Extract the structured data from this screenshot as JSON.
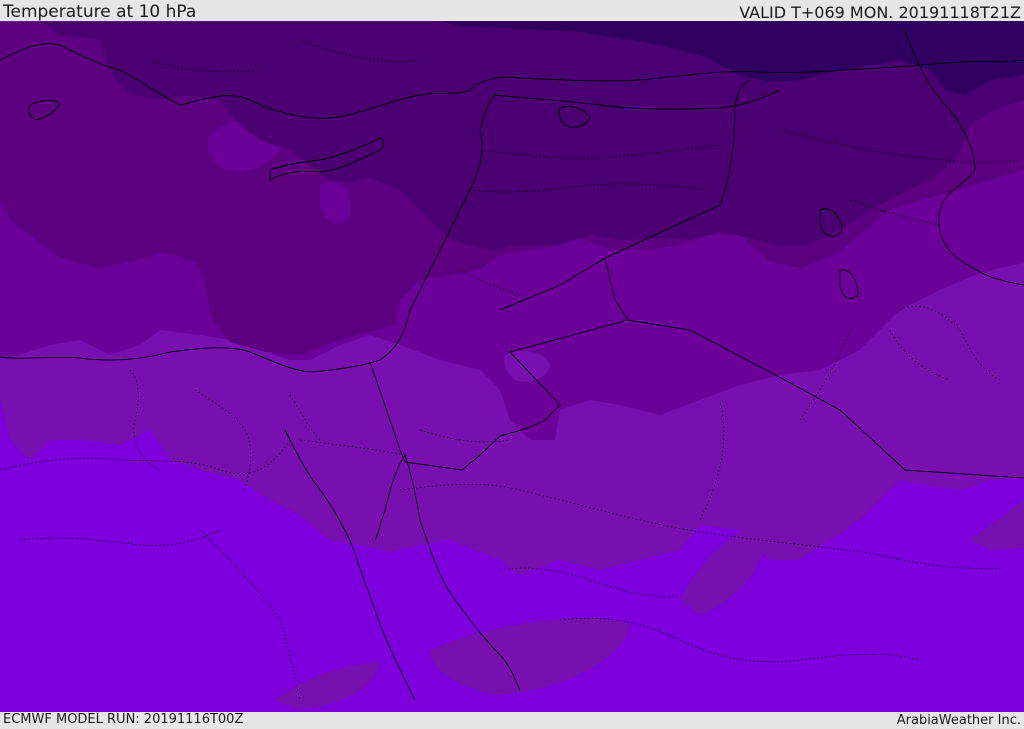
{
  "header": {
    "title": "Temperature at 10 hPa",
    "valid": "VALID T+069 MON. 20191118T21Z"
  },
  "footer": {
    "model_run": "ECMWF MODEL RUN: 20191116T00Z",
    "credit": "ArabiaWeather Inc."
  },
  "map": {
    "variable": "temperature",
    "level": "10 hPa",
    "palette": [
      "#300060",
      "#4a0070",
      "#5c0080",
      "#6a0098",
      "#7810b0",
      "#7d00dc"
    ],
    "boundary_color": "#000000"
  }
}
